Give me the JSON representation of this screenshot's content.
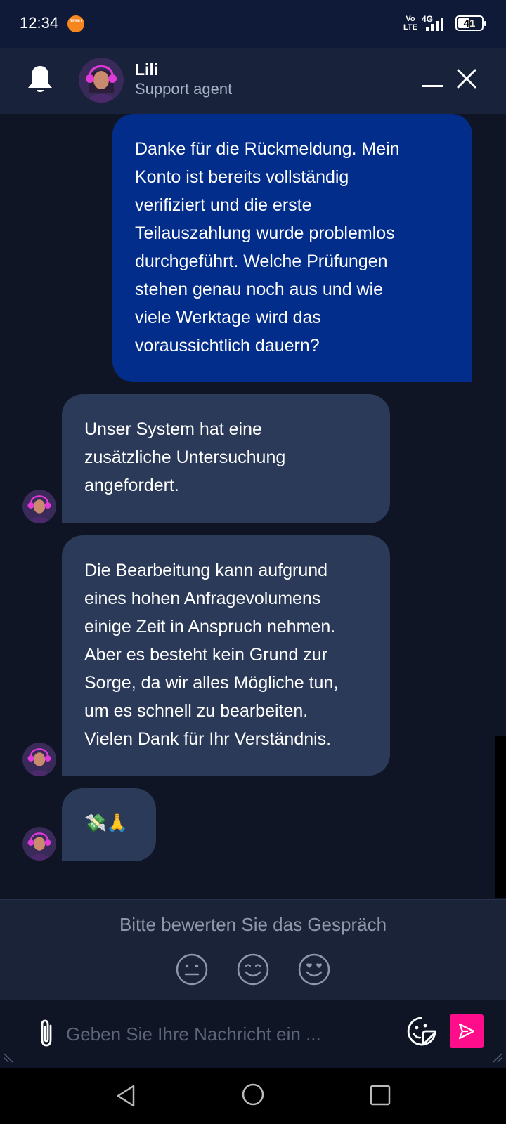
{
  "status_bar": {
    "time": "12:34",
    "notification_badge": "TEMU",
    "network_label": "Vo LTE",
    "network_type": "4G",
    "battery": "41"
  },
  "header": {
    "agent_name": "Lili",
    "agent_role": "Support agent"
  },
  "messages": [
    {
      "sender": "user",
      "text": "Danke für die Rückmeldung. Mein\nKonto ist bereits vollständig\nverifiziert und die erste\nTeilauszahlung wurde problemlos\ndurchgeführt. Welche Prüfungen\nstehen genau noch aus und wie\nviele Werktage wird das\nvoraussichtlich dauern?"
    },
    {
      "sender": "agent",
      "text": "Unser System hat eine\nzusätzliche Untersuchung\nangefordert."
    },
    {
      "sender": "agent",
      "text": "Die Bearbeitung kann aufgrund\neines hohen Anfragevolumens\neinige Zeit in Anspruch nehmen.\nAber es besteht kein Grund zur\nSorge, da wir alles Mögliche tun,\num es schnell zu bearbeiten.\nVielen Dank für Ihr Verständnis."
    },
    {
      "sender": "agent",
      "text": "💸🙏"
    }
  ],
  "rating": {
    "label": "Bitte bewerten Sie das Gespräch",
    "options": [
      "neutral-face",
      "smiling-face",
      "heart-eyes-face"
    ]
  },
  "composer": {
    "placeholder": "Geben Sie Ihre Nachricht ein ..."
  },
  "colors": {
    "user_bubble": "#032d8a",
    "agent_bubble": "#2a3a58",
    "send_button": "#ff0d8a",
    "background": "#0f1524"
  },
  "icons": [
    "bell-icon",
    "minimize-icon",
    "close-icon",
    "paperclip-icon",
    "sticker-icon",
    "send-icon",
    "back-icon",
    "home-icon",
    "recents-icon"
  ]
}
